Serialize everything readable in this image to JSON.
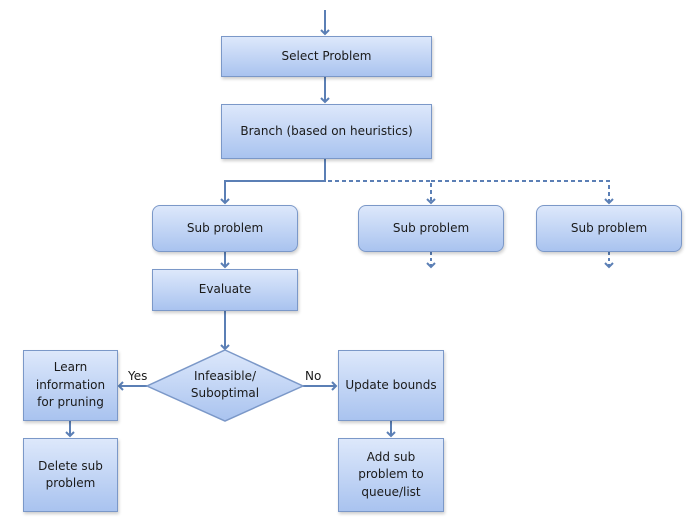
{
  "nodes": {
    "select_problem": "Select Problem",
    "branch": "Branch (based on heuristics)",
    "sub_problem_1": "Sub problem",
    "sub_problem_2": "Sub problem",
    "sub_problem_3": "Sub problem",
    "evaluate": "Evaluate",
    "decision": "Infeasible/ Suboptimal",
    "learn": "Learn information for pruning",
    "delete": "Delete sub problem",
    "update": "Update bounds",
    "add": "Add sub problem to queue/list"
  },
  "edges": {
    "yes_label": "Yes",
    "no_label": "No"
  },
  "colors": {
    "box_fill_top": "#dde8fb",
    "box_fill_bottom": "#a9c3ef",
    "border": "#7b98c8",
    "arrow": "#5b7fb5"
  }
}
